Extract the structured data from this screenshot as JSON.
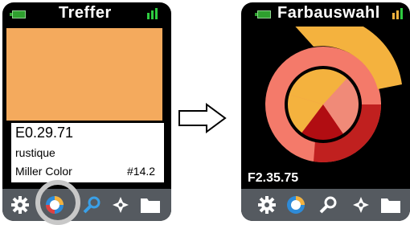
{
  "left_screen": {
    "title": "Treffer",
    "swatch_color": "#F4AA5D",
    "color_code": "E0.29.71",
    "color_name": "rustique",
    "brand": "Miller Color",
    "index": "#14.2",
    "toolbar": [
      "gear-icon",
      "color-wheel-icon",
      "search-icon",
      "compass-icon",
      "folder-icon"
    ],
    "selected_tool": "color-wheel-icon"
  },
  "right_screen": {
    "title": "Farbauswahl",
    "color_code": "F2.35.75",
    "toolbar": [
      "gear-icon",
      "color-wheel-icon",
      "search-icon",
      "compass-icon",
      "folder-icon"
    ]
  },
  "colors": {
    "battery": "#2ea02e",
    "signal": "#2ecc40",
    "toolbar_bg": "#555a60",
    "orange": "#F4AA5D",
    "dark_red": "#c0201f",
    "salmon": "#f47a6a",
    "yellow": "#f4b23e"
  }
}
